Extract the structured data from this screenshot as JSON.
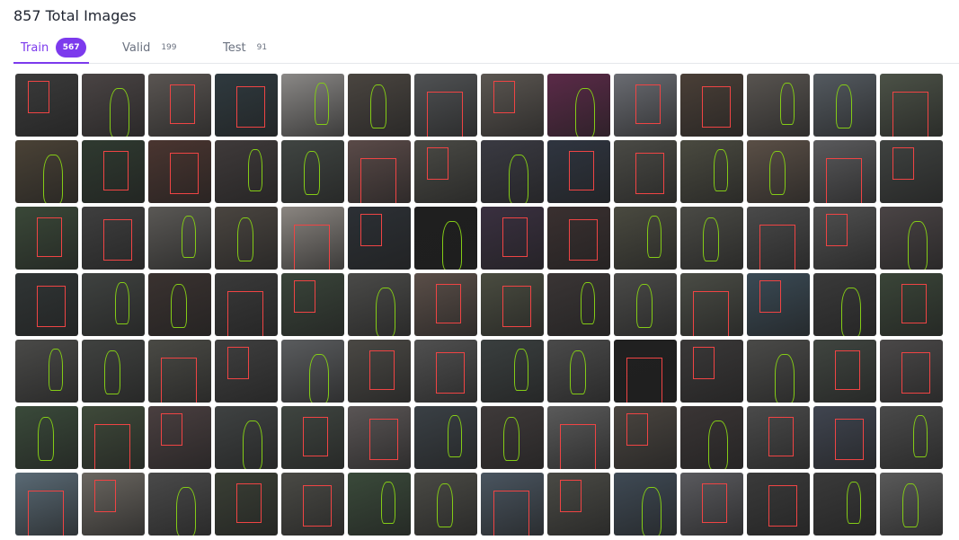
{
  "page": {
    "title": "857 Total Images"
  },
  "tabs": [
    {
      "label": "Train",
      "count": "567",
      "active": true
    },
    {
      "label": "Valid",
      "count": "199",
      "active": false
    },
    {
      "label": "Test",
      "count": "91",
      "active": false
    }
  ],
  "gallery": {
    "item_label": "dataset image thumbnail",
    "annotation_colors": {
      "box": "#ef4444",
      "polygon": "#84cc16"
    },
    "rows": [
      [
        "#3b3b3b",
        "#4a4444",
        "#5a5552",
        "#2f3a3f",
        "#8a8886",
        "#4a4540",
        "#505254",
        "#5b5651",
        "#5b2a48",
        "#6a6c72",
        "#4a3f37",
        "#585450",
        "#545a60",
        "#4c5247"
      ],
      [
        "#4a4236",
        "#2f3a30",
        "#4a3530",
        "#3f3a3a",
        "#404542",
        "#5a4a48",
        "#4a4a45",
        "#3a3a42",
        "#2f3540",
        "#4a4a45",
        "#4a4a40",
        "#5a4f46",
        "#5a5a5c",
        "#3f4240"
      ],
      [
        "#3a4838",
        "#3f3f3f",
        "#5a5855",
        "#4a4540",
        "#8a8580",
        "#2c3035",
        "#1f1f1f",
        "#3a3040",
        "#3a3030",
        "#4a4a40",
        "#4a4a45",
        "#4a4a4a",
        "#505050",
        "#4a4445"
      ],
      [
        "#303535",
        "#3f4240",
        "#3a3230",
        "#3a3a3a",
        "#3a453a",
        "#4a4a48",
        "#5a4e48",
        "#4a4c40",
        "#3a3535",
        "#4a4a48",
        "#4a4c45",
        "#3a4a55",
        "#3a3a3a",
        "#3a4538"
      ],
      [
        "#4a4a48",
        "#404240",
        "#4a4a45",
        "#3f3f3f",
        "#5a5c5e",
        "#4a4844",
        "#505050",
        "#3a3f3f",
        "#4a4a4a",
        "#202020",
        "#3a3838",
        "#4a4a48",
        "#404540",
        "#4a4848"
      ],
      [
        "#3a4a3a",
        "#3f4a3a",
        "#4a3f40",
        "#3f4242",
        "#3f4540",
        "#5a5555",
        "#3a4045",
        "#3f3a3a",
        "#5a5a5a",
        "#4a4540",
        "#3a3535",
        "#4a4a4a",
        "#404550",
        "#4a4a4a"
      ],
      [
        "#5a6a75",
        "#6a6660",
        "#4a4a4a",
        "#3a3f35",
        "#4a4a45",
        "#3a4a3a",
        "#4a4a45",
        "#4a5560",
        "#4a4a45",
        "#3f4a55",
        "#5a5a5e",
        "#3a3a3a",
        "#3a3a3a",
        "#5a5a5a"
      ]
    ]
  }
}
